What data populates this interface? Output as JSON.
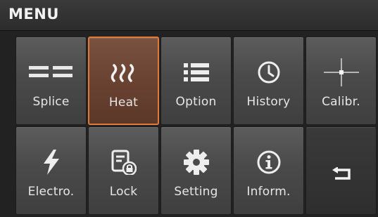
{
  "header": {
    "title": "MENU"
  },
  "tiles": [
    {
      "label": "Splice",
      "icon": "splice-icon"
    },
    {
      "label": "Heat",
      "icon": "heat-icon",
      "selected": true
    },
    {
      "label": "Option",
      "icon": "list-icon"
    },
    {
      "label": "History",
      "icon": "clock-icon"
    },
    {
      "label": "Calibr.",
      "icon": "crosshair-icon"
    },
    {
      "label": "Electro.",
      "icon": "lightning-icon"
    },
    {
      "label": "Lock",
      "icon": "lock-icon"
    },
    {
      "label": "Setting",
      "icon": "gear-icon"
    },
    {
      "label": "Inform.",
      "icon": "info-icon"
    },
    {
      "label": "",
      "icon": "return-icon"
    }
  ],
  "colors": {
    "accent": "#e07a3a",
    "text": "#e6e6e6"
  }
}
